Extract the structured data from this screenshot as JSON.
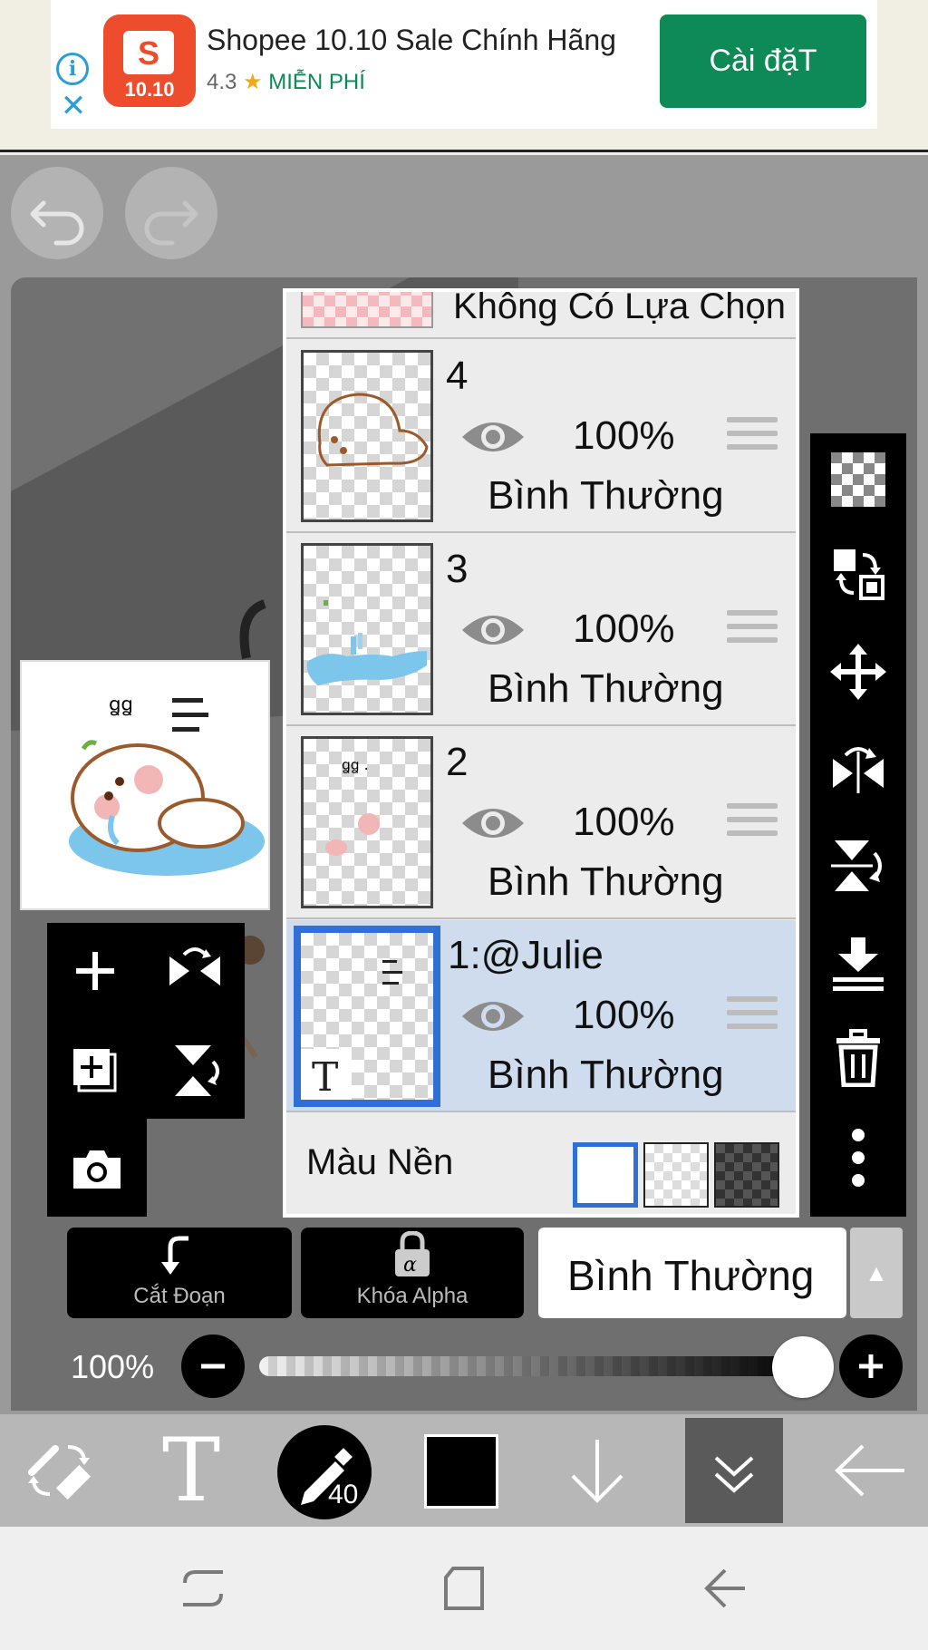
{
  "ad": {
    "title": "Shopee 10.10 Sale Chính Hãng",
    "rating": "4.3",
    "star": "★",
    "price": "MIỄN PHÍ",
    "install": "Cài đặT",
    "logo_text": "10.10",
    "logo_letter": "S"
  },
  "layers": {
    "no_selection": "Không Có Lựa Chọn",
    "items": [
      {
        "name": "4",
        "opacity": "100%",
        "blend": "Bình Thường"
      },
      {
        "name": "3",
        "opacity": "100%",
        "blend": "Bình Thường"
      },
      {
        "name": "2",
        "opacity": "100%",
        "blend": "Bình Thường"
      },
      {
        "name": "1:@Julie",
        "opacity": "100%",
        "blend": "Bình Thường",
        "thumb_badge": "T"
      }
    ],
    "background_label": "Màu Nền"
  },
  "actions": {
    "clip": "Cắt Đoạn",
    "alpha_lock": "Khóa Alpha",
    "blend_mode": "Bình Thường"
  },
  "opacity_slider": {
    "label": "100%",
    "value": 1.0
  },
  "bottom_tools": {
    "brush_size": "40",
    "text_tool": "T"
  },
  "colors": {
    "accent": "#2f6fd6",
    "install_green": "#0d8a56",
    "shopee": "#ee4d2d",
    "selected_layer": "#cfdcee"
  }
}
